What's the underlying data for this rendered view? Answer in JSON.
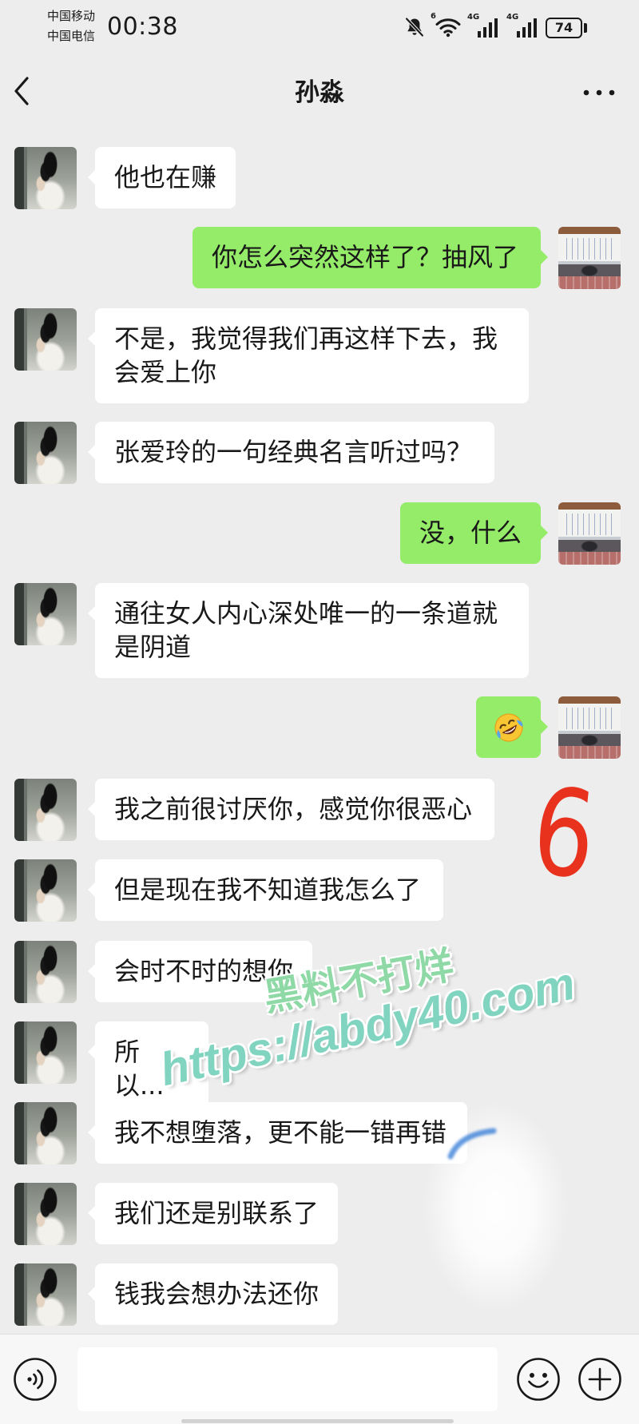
{
  "status_bar": {
    "carrier_primary": "中国移动",
    "carrier_secondary": "中国电信",
    "time": "00:38",
    "wifi_badge": "6",
    "signal_1_label": "4G",
    "signal_2_label": "4G",
    "battery_level": "74",
    "icons": [
      "bell-muted-icon",
      "wifi-icon",
      "signal-bars-icon",
      "signal-bars-icon",
      "battery-icon"
    ]
  },
  "header": {
    "title": "孙淼",
    "back_icon": "chevron-left-icon",
    "menu_icon": "more-horizontal-icon"
  },
  "messages": [
    {
      "text": "他也在赚"
    },
    {
      "text": "你怎么突然这样了？抽风了"
    },
    {
      "text": "不是，我觉得我们再这样下去，我会爱上你"
    },
    {
      "text": "张爱玲的一句经典名言听过吗？"
    },
    {
      "text": "没，什么"
    },
    {
      "text": "通往女人内心深处唯一的一条道就是阴道"
    },
    {
      "emoji_icon": "rolling-on-the-floor-laughing-emoji-icon"
    },
    {
      "text": "我之前很讨厌你，感觉你很恶心"
    },
    {
      "text": "但是现在我不知道我怎么了"
    },
    {
      "text": "会时不时的想你"
    },
    {
      "text": "所以..."
    },
    {
      "text": "我不想堕落，更不能一错再错"
    },
    {
      "text": "我们还是别联系了"
    },
    {
      "text": "钱我会想办法还你"
    }
  ],
  "annotation": {
    "text": "6",
    "color": "#e8321e"
  },
  "watermark": {
    "line_1": "黑料不打烊",
    "line_2": "https://abdy40.com"
  },
  "input_bar": {
    "voice_icon": "voice-icon",
    "emoji_icon": "smile-icon",
    "more_icon": "plus-circle-icon"
  },
  "colors": {
    "background": "#ededed",
    "incoming_bubble": "#ffffff",
    "outgoing_bubble": "#95ec69",
    "text": "#191919",
    "input_bar": "#f7f7f7"
  }
}
